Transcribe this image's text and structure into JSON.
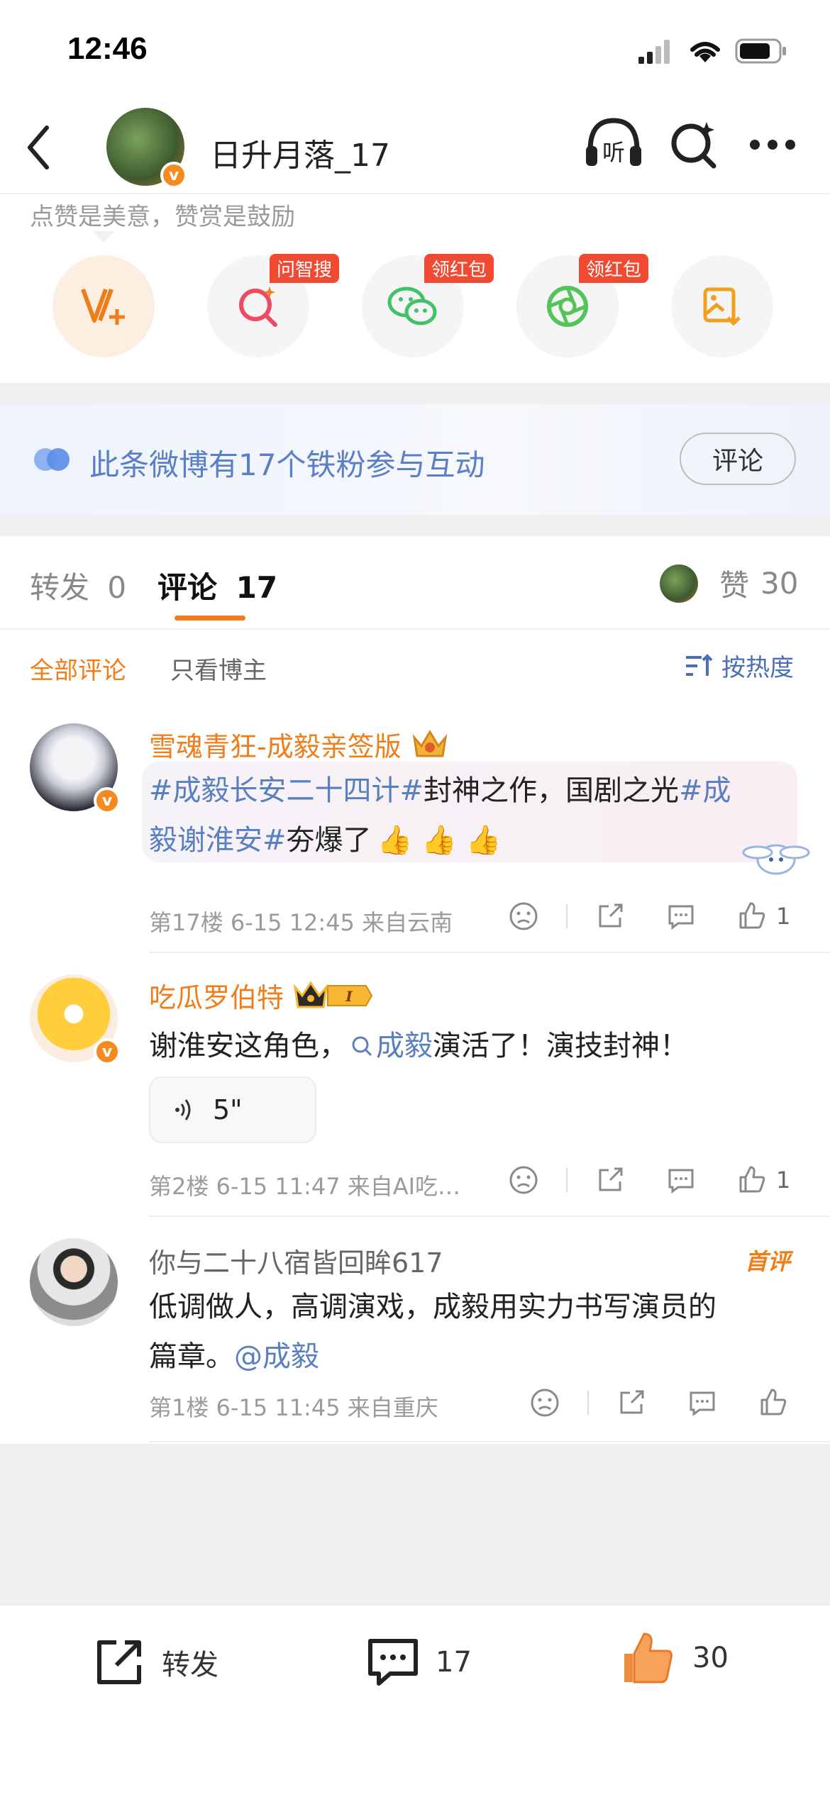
{
  "status": {
    "time": "12:46"
  },
  "nav": {
    "title": "日升月落_17"
  },
  "tip": "点赞是美意，赞赏是鼓励",
  "actions": {
    "tag1": "问智搜",
    "tag2": "领红包",
    "tag3": "领红包"
  },
  "fans": {
    "text": "此条微博有17个铁粉参与互动",
    "button": "评论"
  },
  "tabs": {
    "repost_label": "转发",
    "repost_count": "0",
    "comment_label": "评论",
    "comment_count": "17",
    "like_label": "赞",
    "like_count": "30"
  },
  "filters": {
    "all": "全部评论",
    "owner": "只看博主",
    "sort": "按热度"
  },
  "comments": [
    {
      "name": "雪魂青狂-成毅亲签版",
      "text_parts": [
        "#成毅长安二十四计#",
        "封神之作，国剧之光",
        "#成",
        "毅谢淮安#",
        "夯爆了"
      ],
      "meta": "第17楼 6-15 12:45 来自云南",
      "likes": "1"
    },
    {
      "name": "吃瓜罗伯特",
      "text_parts": [
        "谢淮安这角色，",
        "成毅",
        "演活了！演技封神！"
      ],
      "voice": "5\"",
      "meta": "第2楼 6-15 11:47 来自AI吃…",
      "likes": "1"
    },
    {
      "name": "你与二十八宿皆回眸617",
      "badge": "首评",
      "text_parts": [
        "低调做人，高调演戏，成毅用实力书写演员的",
        "篇章。",
        "@成毅"
      ],
      "meta": "第1楼 6-15 11:45 来自重庆"
    }
  ],
  "bottom": {
    "repost": "转发",
    "comments": "17",
    "likes": "30"
  },
  "colors": {
    "accent": "#f07d1a",
    "link": "#5a7fbf",
    "red": "#f04a33"
  }
}
